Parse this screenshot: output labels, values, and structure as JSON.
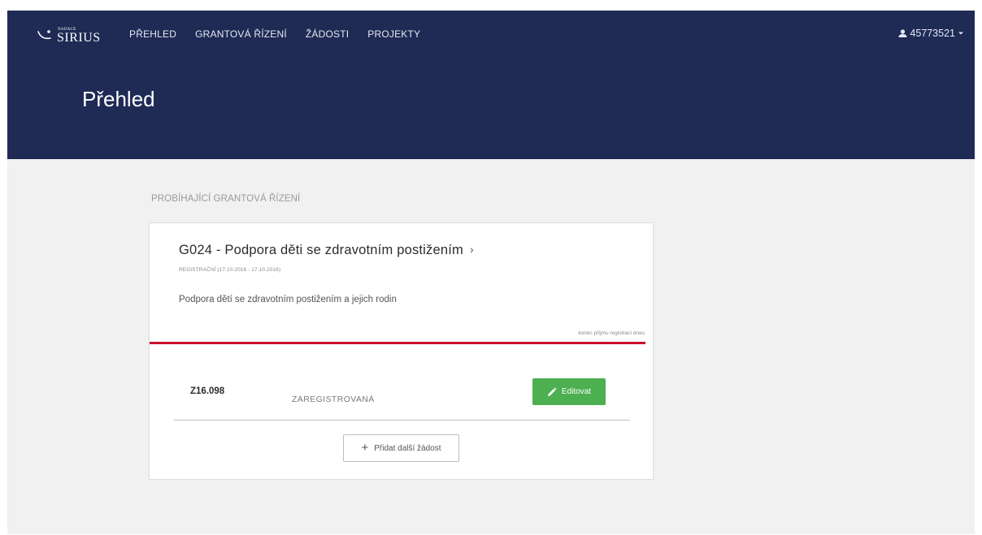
{
  "header": {
    "logo_small": "NADACE",
    "logo_main": "SIRIUS",
    "nav": [
      {
        "label": "PŘEHLED"
      },
      {
        "label": "GRANTOVÁ ŘÍZENÍ"
      },
      {
        "label": "ŽÁDOSTI"
      },
      {
        "label": "PROJEKTY"
      }
    ],
    "user": {
      "id": "45773521",
      "icon": "user-icon",
      "caret": "caret-down-icon"
    },
    "page_title": "Přehled",
    "background_color": "#1f2a55"
  },
  "main": {
    "section_label": "PROBÍHAJÍCÍ GRANTOVÁ ŘÍZENÍ",
    "grant_card": {
      "title": "G024 - Podpora děti se zdravotním postižením",
      "title_chevron": "›",
      "phase": "REGISTRAČNÍ (17.10.2016 - 17.10.2016)",
      "description": "Podpora dětí se zdravotním postižením a jejich rodin",
      "deadline_note": "konec příjmu registrací dnes",
      "accent_color": "#c8102e",
      "applications": [
        {
          "code": "Z16.098",
          "status": "ZAREGISTROVANÁ",
          "edit_label": "Editovat",
          "edit_icon": "pencil-icon",
          "button_color": "#4caf50"
        }
      ],
      "add_label": "Přidat další žádost",
      "add_icon": "plus-icon"
    }
  }
}
